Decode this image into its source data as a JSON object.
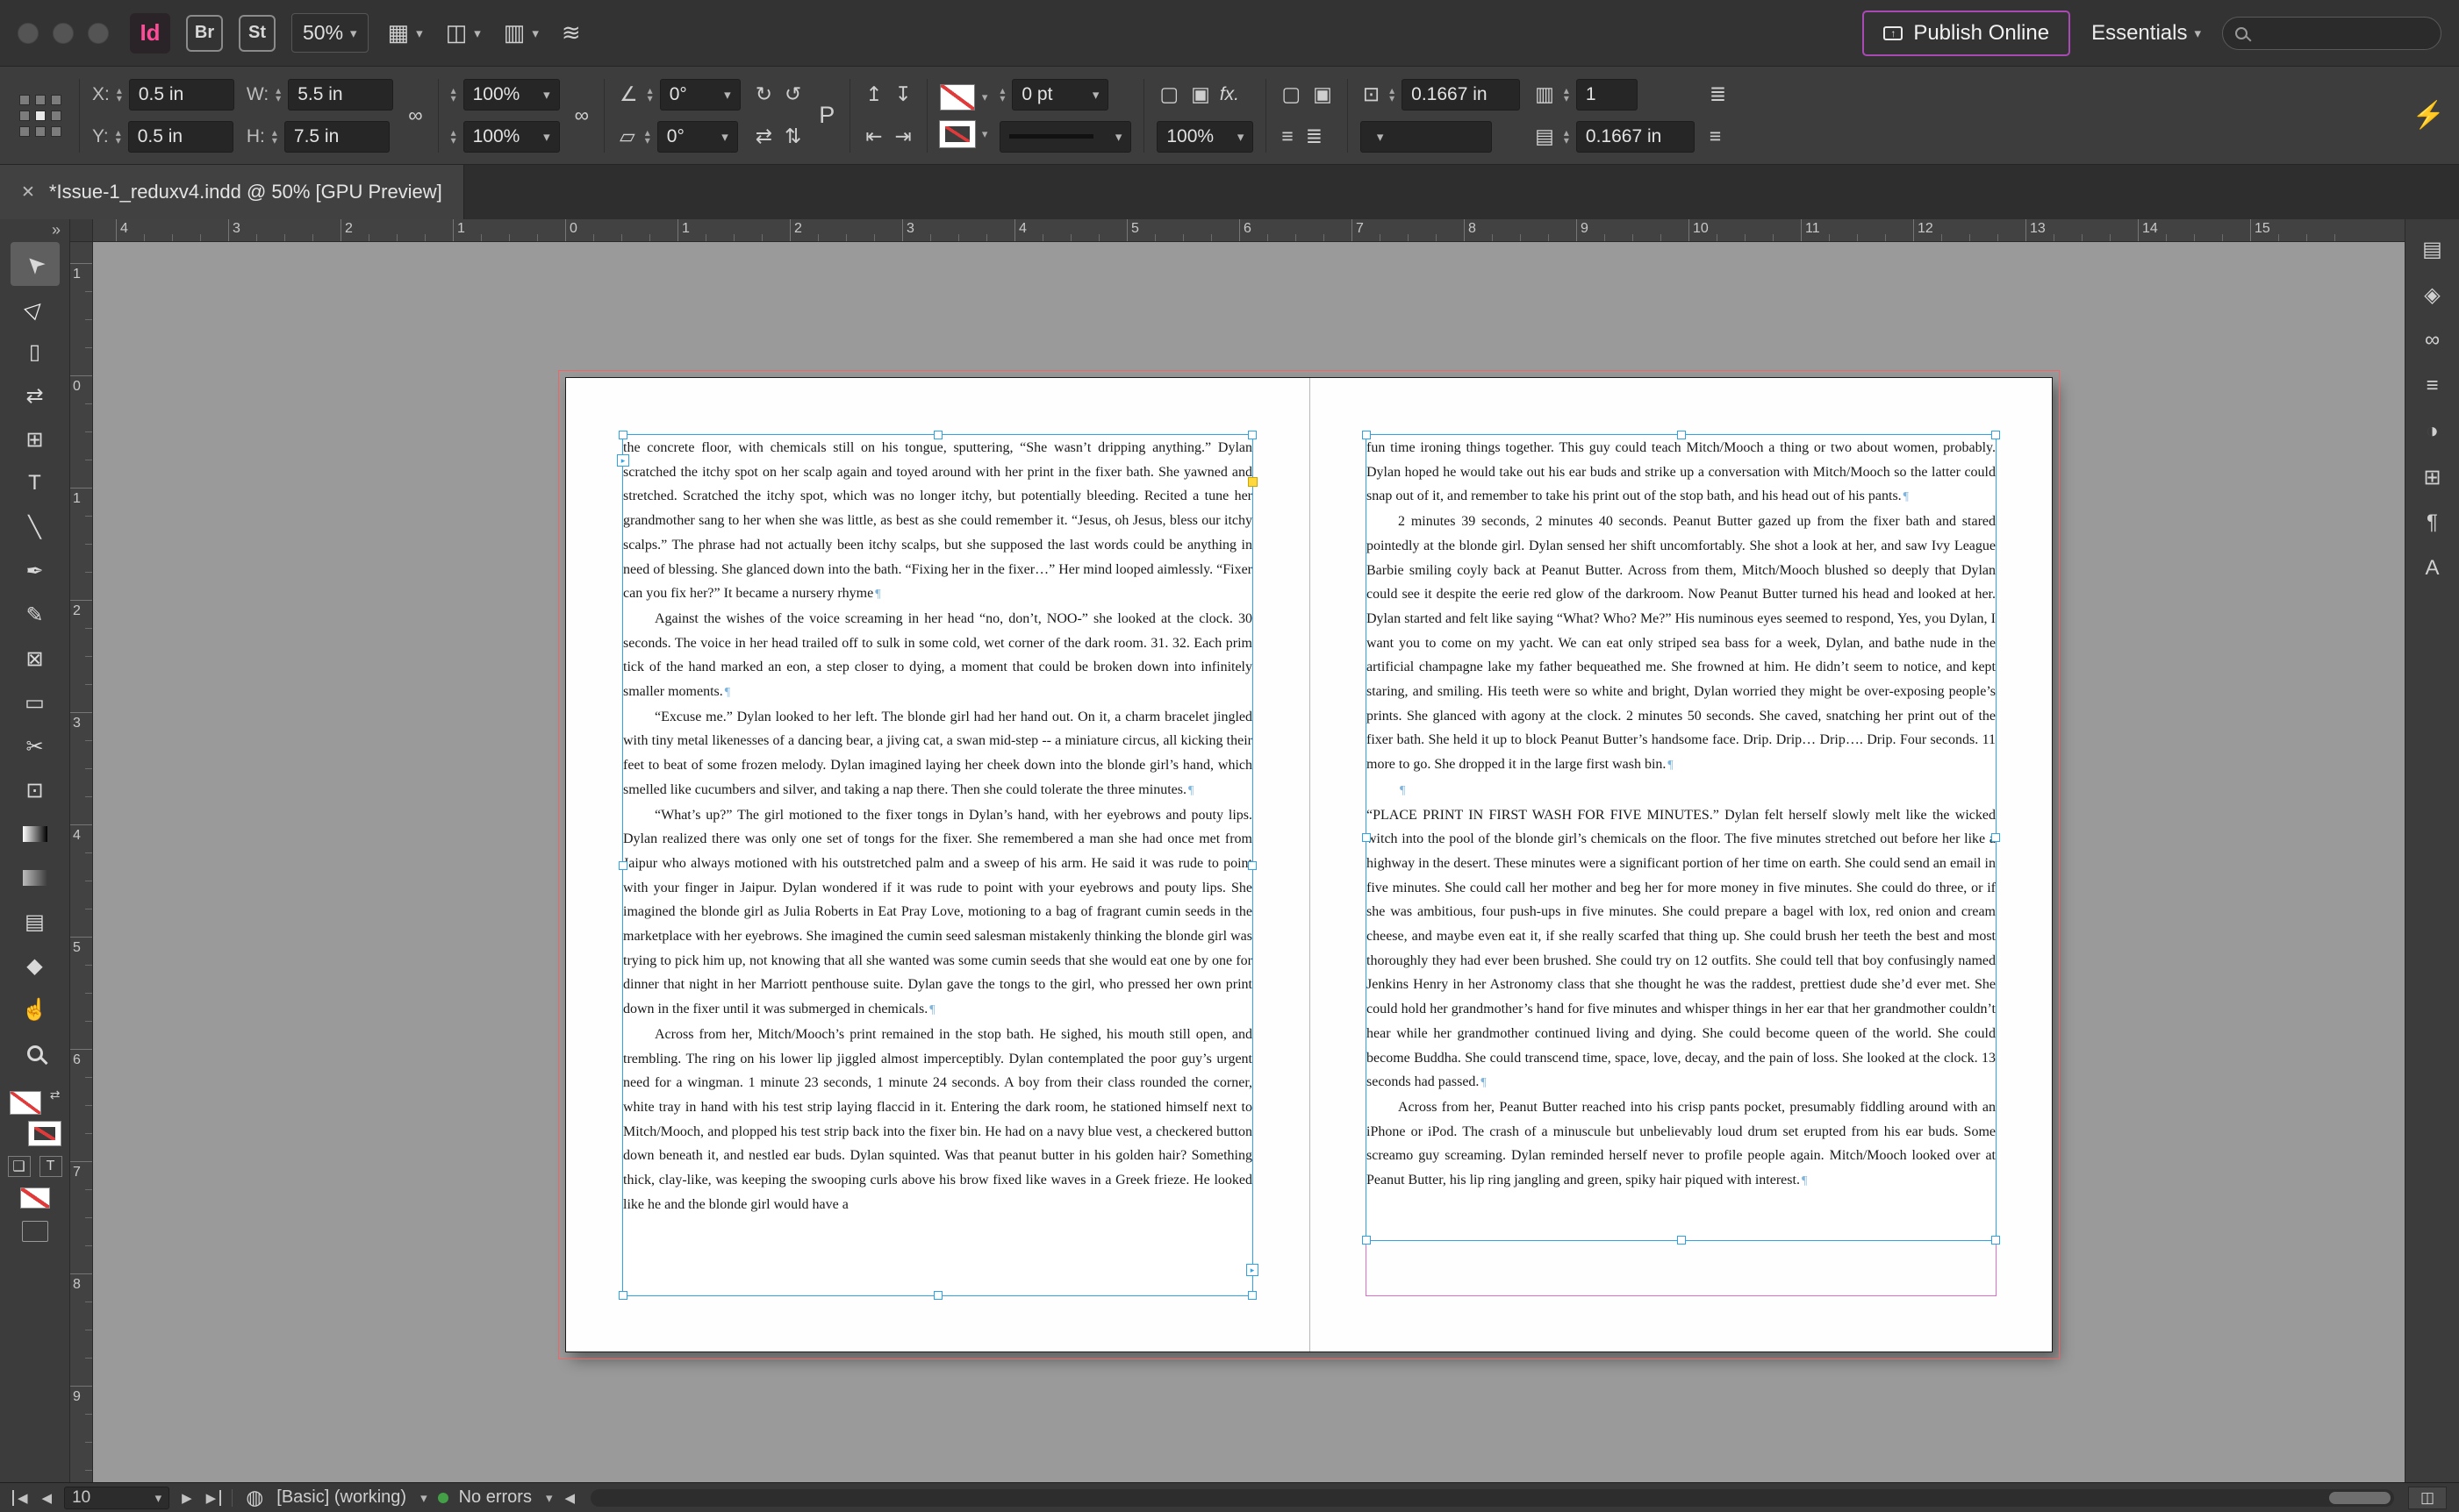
{
  "titlebar": {
    "id_logo": "Id",
    "bridge_logo": "Br",
    "stock_logo": "St",
    "zoom_level": "50%",
    "publish_online": "Publish Online",
    "workspace": "Essentials",
    "search_placeholder": ""
  },
  "icons": {
    "double_chevron": "»",
    "close_tab": "✕",
    "view_options": "▦",
    "screen_mode": "◫",
    "arrange_documents": "▥",
    "gpu_preview": "≋",
    "publish_arrow": "↑",
    "chain_link": "∞",
    "angle": "∠",
    "shear": "▱",
    "rotate_cw": "↻",
    "rotate_ccw": "↺",
    "flip_h": "⇄",
    "flip_v": "⇅",
    "fit_up": "↥",
    "fit_down": "↧",
    "fit_left": "⇤",
    "fit_right": "⇥",
    "effect_a": "▢",
    "effect_b": "▣",
    "wrap_none": "▢",
    "wrap_around": "▣",
    "align_a": "≡",
    "align_b": "≣",
    "inset_icon": "⊡",
    "columns_icon": "▥",
    "gutter_icon": "▤",
    "lightning": "⚡",
    "swap_arrows": "⇄",
    "container_toggle": "❑",
    "text_toggle": "T",
    "nav_prev": "◀",
    "nav_next": "▶",
    "preflight": "◍",
    "scroll_left": "◀",
    "corner": "◫",
    "outport_arrow": "▸",
    "inport_arrow": "▸"
  },
  "controlbar": {
    "x_label": "X:",
    "x_value": "0.5 in",
    "y_label": "Y:",
    "y_value": "0.5 in",
    "w_label": "W:",
    "w_value": "5.5 in",
    "h_label": "H:",
    "h_value": "7.5 in",
    "scale_x": "100%",
    "scale_y": "100%",
    "rotation": "0°",
    "shear": "0°",
    "flip_preview": "P",
    "stroke_weight": "0 pt",
    "fx_label": "fx.",
    "opacity": "100%",
    "inset_value": "0.1667 in",
    "columns_value": "1",
    "gutter_value": "0.1667 in"
  },
  "tabbar": {
    "title": "*Issue-1_reduxv4.indd @ 50% [GPU Preview]"
  },
  "rulers": {
    "horizontal": [
      "4",
      "3",
      "2",
      "1",
      "0",
      "1",
      "2",
      "3",
      "4",
      "5",
      "6",
      "7",
      "8",
      "9",
      "10",
      "11",
      "12",
      "13",
      "14",
      "15"
    ],
    "vertical": [
      "1",
      "0",
      "1",
      "2",
      "3",
      "4",
      "5",
      "6",
      "7",
      "8",
      "9"
    ]
  },
  "tools": [
    {
      "name": "tool-selection",
      "glyph": "➤",
      "state": "active"
    },
    {
      "name": "tool-direct-selection",
      "glyph": "▷",
      "state": ""
    },
    {
      "name": "tool-page",
      "glyph": "▯",
      "state": ""
    },
    {
      "name": "tool-gap",
      "glyph": "⇄",
      "state": ""
    },
    {
      "name": "tool-content-collector",
      "glyph": "⊞",
      "state": ""
    },
    {
      "name": "tool-type",
      "glyph": "T",
      "state": ""
    },
    {
      "name": "tool-line",
      "glyph": "╲",
      "state": ""
    },
    {
      "name": "tool-pen",
      "glyph": "✒",
      "state": ""
    },
    {
      "name": "tool-pencil",
      "glyph": "✎",
      "state": ""
    },
    {
      "name": "tool-rectangle-frame",
      "glyph": "⊠",
      "state": ""
    },
    {
      "name": "tool-rectangle",
      "glyph": "▭",
      "state": ""
    },
    {
      "name": "tool-scissors",
      "glyph": "✂",
      "state": ""
    },
    {
      "name": "tool-free-transform",
      "glyph": "⊡",
      "state": ""
    },
    {
      "name": "tool-gradient-swatch",
      "glyph": "",
      "state": ""
    },
    {
      "name": "tool-gradient-feather",
      "glyph": "",
      "state": ""
    },
    {
      "name": "tool-note",
      "glyph": "▤",
      "state": ""
    },
    {
      "name": "tool-color-theme",
      "glyph": "◆",
      "state": ""
    },
    {
      "name": "tool-hand",
      "glyph": "☝",
      "state": ""
    },
    {
      "name": "tool-zoom",
      "glyph": "",
      "state": ""
    }
  ],
  "dock": [
    {
      "name": "pages-panel-icon",
      "glyph": "▤"
    },
    {
      "name": "layers-panel-icon",
      "glyph": "◈"
    },
    {
      "name": "links-panel-icon",
      "glyph": "∞"
    },
    {
      "name": "stroke-panel-icon",
      "glyph": "≡"
    },
    {
      "name": "color-panel-icon",
      "glyph": "◑"
    },
    {
      "name": "swatches-panel-icon",
      "glyph": "⊞"
    },
    {
      "name": "paragraph-styles-panel-icon",
      "glyph": "¶"
    },
    {
      "name": "character-styles-panel-icon",
      "glyph": "A"
    }
  ],
  "document": {
    "left_page": [
      {
        "style": "flush",
        "text": "the concrete floor, with chemicals still on his tongue, sputtering, “She wasn’t dripping anything.” Dylan scratched the itchy spot on her scalp again and toyed around with her print in the fixer bath. She yawned and stretched. Scratched the itchy spot, which was no longer itchy, but potentially bleeding. Recited a tune her grandmother sang to her when she was little, as best as she could remember it. “Jesus, oh Jesus, bless our itchy scalps.” The phrase had not actually been itchy scalps, but she supposed the last words could be anything in need of blessing. She glanced down into the bath. “Fixing her in the fixer…” Her mind looped aimlessly. “Fixer can you fix her?” It became a nursery rhyme"
      },
      {
        "style": "indent",
        "text": "Against the wishes of the voice screaming in her head “no, don’t, NOO-” she looked at the clock. 30 seconds. The voice in her head trailed off to sulk in some cold, wet corner of the dark room. 31. 32. Each prim tick of the hand marked an eon, a step closer to dying, a moment that could be broken down into infinitely smaller moments."
      },
      {
        "style": "indent",
        "text": "“Excuse me.” Dylan looked to her left. The blonde girl had her hand out. On it, a charm bracelet jingled with tiny metal likenesses of a dancing bear, a jiving cat, a swan mid-step -- a miniature circus, all kicking their feet to beat of some frozen melody. Dylan imagined laying her cheek down into the blonde girl’s hand, which smelled like cucumbers and silver, and taking a nap there. Then she could tolerate the three minutes."
      },
      {
        "style": "indent",
        "text": "“What’s up?” The girl motioned to the fixer tongs in Dylan’s hand, with her eyebrows and pouty lips. Dylan realized there was only one set of tongs for the fixer. She remembered a man she had once met from Jaipur who always motioned with his outstretched palm and a sweep of his arm. He said it was rude to point with your finger in Jaipur. Dylan wondered if it was rude to point with your eyebrows and pouty lips. She imagined the blonde girl as Julia Roberts in Eat Pray Love, motioning to a bag of fragrant cumin seeds in the marketplace with her eyebrows. She imagined the cumin seed salesman mistakenly thinking the blonde girl was trying to pick him up, not knowing that all she wanted was some cumin seeds that she would eat one by one for dinner that night in her Marriott penthouse suite. Dylan gave the tongs to the girl, who pressed her own print down in the fixer until it was submerged in chemicals."
      },
      {
        "style": "indent cont",
        "text": "Across from her, Mitch/Mooch’s print remained in the stop bath. He sighed, his mouth still open, and trembling. The ring on his lower lip jiggled almost imperceptibly. Dylan contemplated the poor guy’s urgent need for a wingman. 1 minute 23 seconds, 1 minute 24 seconds. A boy from their class rounded the corner, white tray in hand with his test strip laying flaccid in it. Entering the dark room, he stationed himself next to Mitch/Mooch, and plopped his test strip back into the fixer bin. He had on a navy blue vest, a checkered button down beneath it, and nestled ear buds. Dylan squinted. Was that peanut butter in his golden hair? Something thick, clay-like, was keeping the swooping curls above his brow fixed like waves in a Greek frieze. He looked like he and the blonde girl would have a"
      }
    ],
    "right_page": [
      {
        "style": "flush",
        "text": "fun time ironing things together. This guy could teach Mitch/Mooch a thing or two about women, probably. Dylan hoped he would take out his ear buds and strike up a conversation with Mitch/Mooch so the latter could snap out of it, and remember to take his print out of the stop bath, and his head out of his pants."
      },
      {
        "style": "indent",
        "text": "2 minutes 39 seconds, 2 minutes 40 seconds. Peanut Butter gazed up from the fixer bath and stared pointedly at the blonde girl. Dylan sensed her shift uncomfortably. She shot a look at her, and saw Ivy League Barbie smiling coyly back at Peanut Butter. Across from them, Mitch/Mooch blushed so deeply that Dylan could see it despite the eerie red glow of the darkroom. Now Peanut Butter turned his head and looked at her. Dylan started and felt like saying “What? Who? Me?” His numinous eyes seemed to respond, Yes, you Dylan, I want you to come on my yacht. We can eat only striped sea bass for a week, Dylan, and bathe nude in the artificial champagne lake my father bequeathed me. She frowned at him. He didn’t seem to notice, and kept staring, and smiling. His teeth were so white and bright, Dylan worried they might be over-exposing people’s prints. She glanced with agony at the clock. 2 minutes 50 seconds. She caved, snatching her print out of the fixer bath. She held it up to block Peanut Butter’s handsome face. Drip. Drip… Drip…. Drip. Four seconds. 11 more to go. She dropped it in the large first wash bin."
      },
      {
        "style": "indent",
        "text": ""
      },
      {
        "style": "flush",
        "text": "“PLACE PRINT IN FIRST WASH FOR FIVE MINUTES.” Dylan felt herself slowly melt like the wicked witch into the pool of the blonde girl’s chemicals on the floor. The five minutes stretched out before her like a highway in the desert. These minutes were a significant portion of her time on earth. She could send an email in five minutes. She could call her mother and beg her for more money in five minutes. She could do three, or if she was ambitious, four push-ups in five minutes. She could prepare a bagel with lox, red onion and cream cheese, and maybe even eat it, if she really scarfed that thing up. She could brush her teeth the best and most thoroughly they had ever been brushed. She could try on 12 outfits. She could tell that boy confusingly named Jenkins Henry in her Astronomy class that she thought he was the raddest, prettiest dude she’d ever met. She could hold her grandmother’s hand for five minutes and whisper things in her ear that her grandmother couldn’t hear while her grandmother continued living and dying. She could become queen of the world. She could become Buddha. She could transcend time, space, love, decay, and the pain of loss. She looked at the clock. 13 seconds had passed."
      },
      {
        "style": "indent",
        "text": "Across from her, Peanut Butter reached into his crisp pants pocket, presumably fiddling around with an iPhone or iPod. The crash of a minuscule but unbelievably loud drum set erupted from his ear buds. Some screamo guy screaming. Dylan reminded herself never to profile people again. Mitch/Mooch looked over at Peanut Butter, his lip ring jangling and green, spiky hair piqued with interest."
      }
    ]
  },
  "statusbar": {
    "page_number": "10",
    "preflight_profile": "[Basic] (working)",
    "errors": "No errors"
  }
}
